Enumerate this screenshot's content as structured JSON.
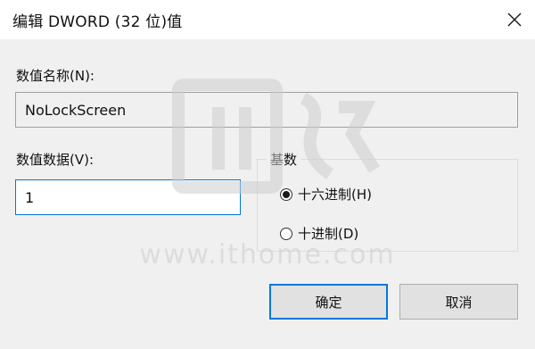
{
  "window": {
    "title": "编辑 DWORD (32 位)值"
  },
  "value_name": {
    "label": "数值名称(N):",
    "value": "NoLockScreen"
  },
  "value_data": {
    "label": "数值数据(V):",
    "value": "1"
  },
  "base": {
    "title": "基数",
    "options": [
      {
        "label": "十六进制(H)",
        "selected": true
      },
      {
        "label": "十进制(D)",
        "selected": false
      }
    ]
  },
  "buttons": {
    "ok": "确定",
    "cancel": "取消"
  },
  "watermark": {
    "text": "www.ithome.com"
  },
  "colors": {
    "accent": "#0078d7",
    "dialog_bg": "#f0f0f0"
  }
}
